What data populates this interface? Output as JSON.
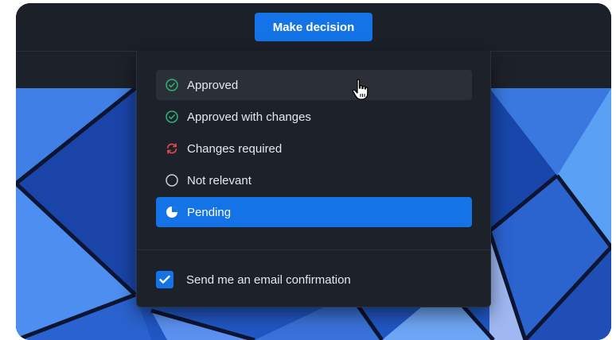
{
  "header": {
    "make_decision_label": "Make decision"
  },
  "decision_menu": {
    "options": [
      {
        "label": "Approved",
        "icon": "check-circle-icon",
        "state": "hover"
      },
      {
        "label": "Approved with changes",
        "icon": "check-circle-icon",
        "state": "default"
      },
      {
        "label": "Changes required",
        "icon": "refresh-arrows-icon",
        "state": "default"
      },
      {
        "label": "Not relevant",
        "icon": "empty-circle-icon",
        "state": "default"
      },
      {
        "label": "Pending",
        "icon": "half-circle-icon",
        "state": "selected"
      }
    ],
    "email_confirmation": {
      "label": "Send me an email confirmation",
      "checked": true
    }
  },
  "colors": {
    "accent": "#1473e6",
    "approved_green": "#2fb37a",
    "changes_red": "#e8484b",
    "panel_bg": "#1d2129"
  }
}
